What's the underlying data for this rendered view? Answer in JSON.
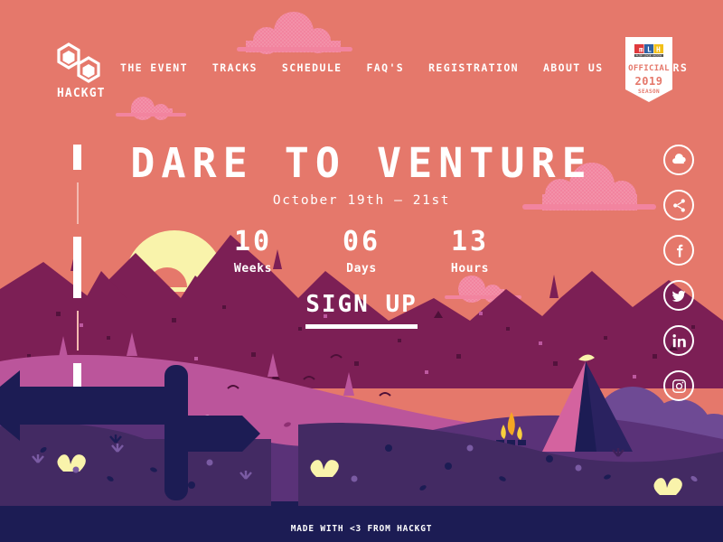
{
  "brand": {
    "logo_icon": "hexagon-logo-icon",
    "name": "HACKGT"
  },
  "nav": {
    "items": [
      {
        "label": "THE EVENT",
        "name": "nav-the-event"
      },
      {
        "label": "TRACKS",
        "name": "nav-tracks"
      },
      {
        "label": "SCHEDULE",
        "name": "nav-schedule"
      },
      {
        "label": "FAQ'S",
        "name": "nav-faqs"
      },
      {
        "label": "REGISTRATION",
        "name": "nav-registration"
      },
      {
        "label": "ABOUT US",
        "name": "nav-about-us"
      },
      {
        "label": "SPONSORS",
        "name": "nav-sponsors"
      }
    ]
  },
  "mlh_badge": {
    "logo_m": "m",
    "logo_l": "L",
    "logo_h": "H",
    "tagline": "MAJOR LEAGUE HACKING",
    "official": "OFFICIAL",
    "year": "2019",
    "season": "SEASON"
  },
  "hero": {
    "title": "DARE TO VENTURE",
    "subtitle": "October 19th – 21st",
    "countdown": [
      {
        "value": "10",
        "label": "Weeks"
      },
      {
        "value": "06",
        "label": "Days"
      },
      {
        "value": "13",
        "label": "Hours"
      }
    ],
    "cta_label": "SIGN UP"
  },
  "social": {
    "items": [
      {
        "name": "cloud-icon",
        "label": "Cloud"
      },
      {
        "name": "share-icon",
        "label": "Share"
      },
      {
        "name": "facebook-icon",
        "label": "Facebook"
      },
      {
        "name": "twitter-icon",
        "label": "Twitter"
      },
      {
        "name": "linkedin-icon",
        "label": "LinkedIn"
      },
      {
        "name": "instagram-icon",
        "label": "Instagram"
      }
    ]
  },
  "footer": {
    "text": "MADE WITH <3 FROM HACKGT"
  },
  "colors": {
    "sky": "#e5786b",
    "cloud_pink": "#f2849f",
    "sun_yellow": "#f9f3ab",
    "mountain_dark": "#7c1f55",
    "mountain_mid": "#bb559b",
    "hill_purple": "#5a3278",
    "foreground_navy": "#1c1c54",
    "tent_pink": "#d4639f",
    "fire_orange": "#f5a623",
    "white": "#ffffff"
  }
}
